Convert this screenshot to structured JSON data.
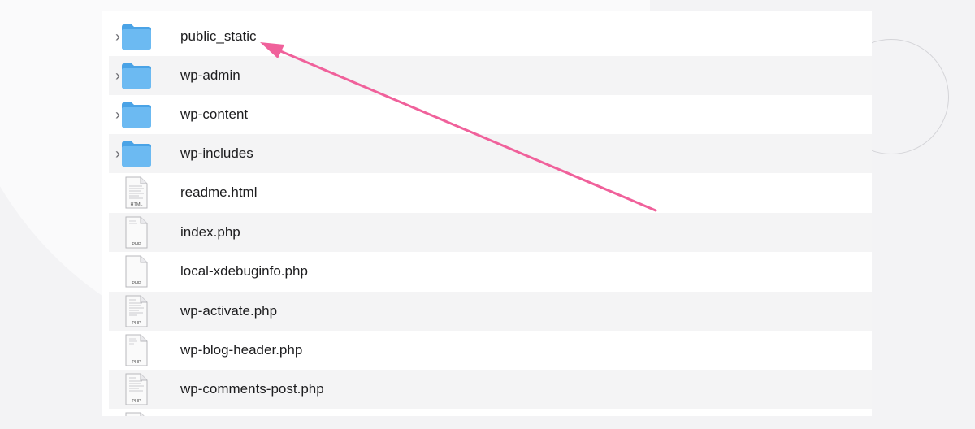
{
  "files": [
    {
      "name": "public_static",
      "kind": "folder",
      "icon": "folder-icon",
      "expandable": true
    },
    {
      "name": "wp-admin",
      "kind": "folder",
      "icon": "folder-icon",
      "expandable": true
    },
    {
      "name": "wp-content",
      "kind": "folder",
      "icon": "folder-icon",
      "expandable": true
    },
    {
      "name": "wp-includes",
      "kind": "folder",
      "icon": "folder-icon",
      "expandable": true
    },
    {
      "name": "readme.html",
      "kind": "file",
      "icon": "html-file-icon",
      "badge": "HTML"
    },
    {
      "name": "index.php",
      "kind": "file",
      "icon": "php-file-icon",
      "badge": "PHP"
    },
    {
      "name": "local-xdebuginfo.php",
      "kind": "file",
      "icon": "php-file-icon",
      "badge": "PHP"
    },
    {
      "name": "wp-activate.php",
      "kind": "file",
      "icon": "php-file-icon",
      "badge": "PHP"
    },
    {
      "name": "wp-blog-header.php",
      "kind": "file",
      "icon": "php-file-icon",
      "badge": "PHP"
    },
    {
      "name": "wp-comments-post.php",
      "kind": "file",
      "icon": "php-file-icon",
      "badge": "PHP"
    }
  ],
  "chevron": "›",
  "colors": {
    "arrow": "#f0619b",
    "folder": "#5ab1ee",
    "row_alt": "#f4f4f5"
  },
  "annotation": {
    "icon": "arrow-annotation",
    "points_to": "public_static"
  }
}
